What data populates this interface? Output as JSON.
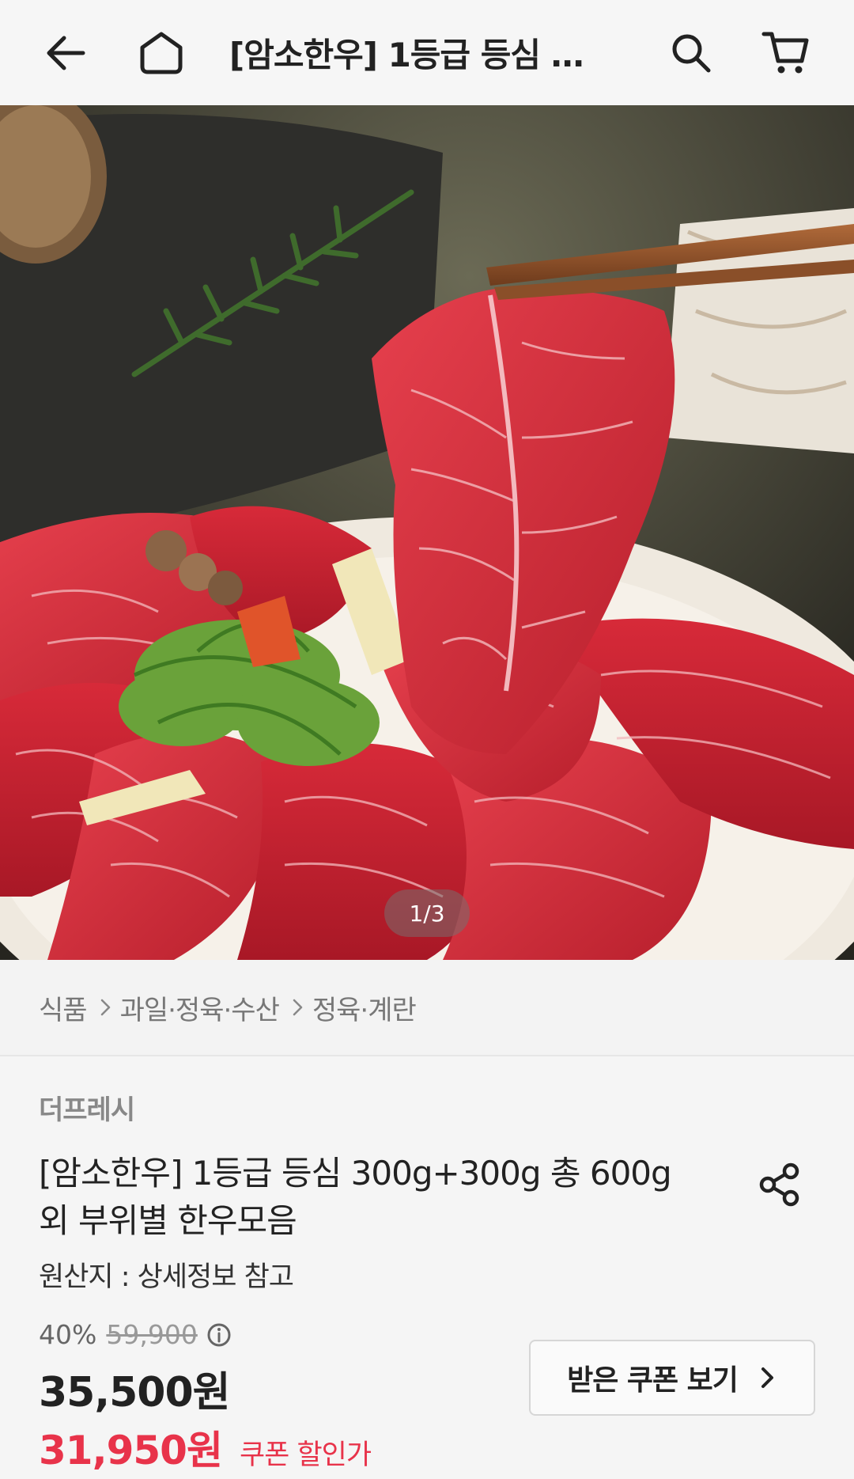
{
  "header": {
    "title": "[암소한우] 1등급 등심 …",
    "icons": [
      "back-arrow-icon",
      "home-icon",
      "search-icon",
      "cart-icon"
    ]
  },
  "gallery": {
    "counter": "1/3"
  },
  "breadcrumb": {
    "items": [
      "식품",
      "과일·정육·수산",
      "정육·계란"
    ]
  },
  "product": {
    "seller": "더프레시",
    "title": "[암소한우] 1등급 등심 300g+300g 총 600g 외 부위별 한우모음",
    "origin": "원산지 : 상세정보 참고",
    "discount_rate": "40%",
    "original_price": "59,900",
    "price": "35,500원",
    "coupon_price": "31,950원",
    "coupon_label": "쿠폰 할인가",
    "coupon_button": "받은 쿠폰 보기"
  },
  "colors": {
    "accent_red": "#e8334a",
    "text_dark": "#222222",
    "text_muted": "#777777"
  }
}
